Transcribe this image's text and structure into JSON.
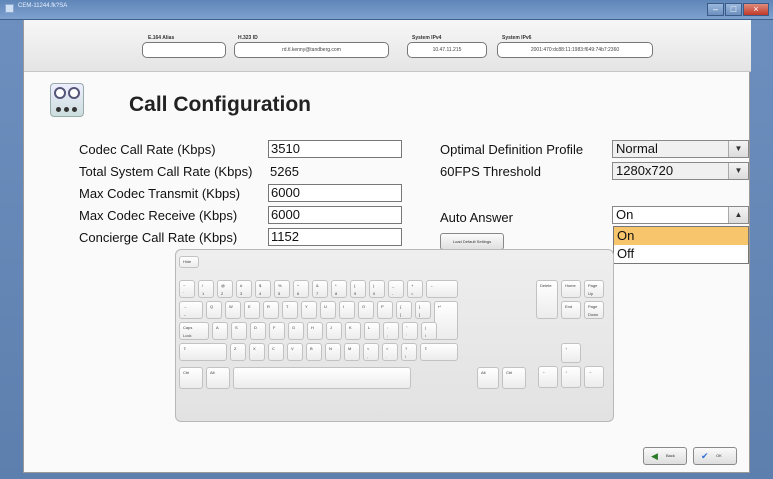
{
  "window": {
    "title": "CEM-11244.fk?SA"
  },
  "header": {
    "e164_label": "E.164 Alias",
    "e164_value": "",
    "h323_label": "H.323 ID",
    "h323_value": "rd.tl.kenny@tandberg.com",
    "ipv4_label": "System IPv4",
    "ipv4_value": "10.47.11.215",
    "ipv6_label": "System IPv6",
    "ipv6_value": "2001:470:dc88:11:1983:f649:74b7:2360"
  },
  "page": {
    "title": "Call Configuration"
  },
  "fields": {
    "codec_call_rate_label": "Codec Call Rate (Kbps)",
    "codec_call_rate_value": "3510",
    "total_system_label": "Total System Call Rate (Kbps)",
    "total_system_value": "5265",
    "max_transmit_label": "Max Codec Transmit (Kbps)",
    "max_transmit_value": "6000",
    "max_receive_label": "Max Codec Receive (Kbps)",
    "max_receive_value": "6000",
    "concierge_label": "Concierge Call Rate (Kbps)",
    "concierge_value": "1152"
  },
  "right": {
    "odp_label": "Optimal Definition Profile",
    "odp_value": "Normal",
    "fps_label": "60FPS Threshold",
    "fps_value": "1280x720",
    "auto_label": "Auto Answer",
    "auto_value": "On",
    "auto_options": [
      "On",
      "Off"
    ],
    "load_default": "Load Default Settings"
  },
  "keyboard": {
    "hide": "Hide",
    "logo": "cisco",
    "row1": [
      [
        "~",
        "`"
      ],
      [
        "!",
        "1"
      ],
      [
        "@",
        "2"
      ],
      [
        "#",
        "3"
      ],
      [
        "$",
        "4"
      ],
      [
        "%",
        "5"
      ],
      [
        "^",
        "6"
      ],
      [
        "&",
        "7"
      ],
      [
        "*",
        "8"
      ],
      [
        "(",
        "9"
      ],
      [
        ")",
        "0"
      ],
      [
        "_",
        "-"
      ],
      [
        "+",
        "="
      ]
    ],
    "backspace": "←",
    "row2": [
      "Q",
      "W",
      "E",
      "R",
      "T",
      "Y",
      "U",
      "I",
      "O",
      "P"
    ],
    "row2_extra": [
      [
        "{",
        "["
      ],
      [
        "}",
        "]"
      ]
    ],
    "tab_top": "→",
    "tab_bottom": "←",
    "enter": "↵",
    "caps_top": "Caps",
    "caps_bottom": "Lock",
    "row3": [
      "A",
      "S",
      "D",
      "F",
      "G",
      "H",
      "J",
      "K",
      "L"
    ],
    "row3_extra": [
      [
        ":",
        ";"
      ],
      [
        "\"",
        "'"
      ],
      [
        "|",
        "\\"
      ]
    ],
    "shift": "⇧",
    "row4": [
      "Z",
      "X",
      "C",
      "V",
      "B",
      "N",
      "M"
    ],
    "row4_extra": [
      [
        "<",
        ","
      ],
      [
        ">",
        "."
      ],
      [
        "?",
        "/"
      ]
    ],
    "shift_right": "⇧",
    "ctrl": "Ctrl",
    "alt": "Alt",
    "alt_right": "Alt",
    "ctrl_right": "Ctrl",
    "delete": "Delete",
    "home": "Home",
    "end": "End",
    "page_up_top": "Page",
    "page_up_bottom": "Up",
    "page_down_top": "Page",
    "page_down_bottom": "Down",
    "arrow_up": "↑",
    "arrow_left": "←",
    "arrow_down": "↓",
    "arrow_right": "→"
  },
  "footer": {
    "back": "Back",
    "ok": "OK"
  },
  "colors": {
    "selected_option": "#f7c56b",
    "titlebar": "#5f86b8",
    "ok_check": "#2f6fd6",
    "back_arrow": "#2a7a2a"
  },
  "icons": {
    "back": "back-arrow-icon",
    "ok": "check-icon",
    "panel": "gauges-icon"
  }
}
